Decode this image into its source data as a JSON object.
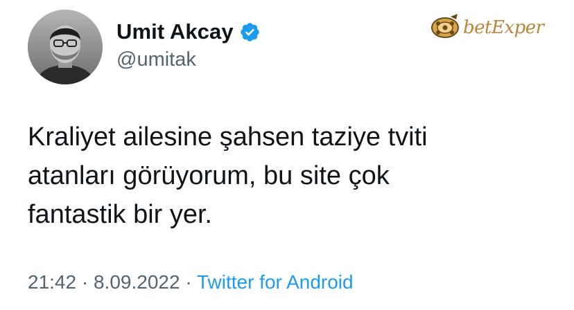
{
  "author": {
    "display_name": "Umit Akcay",
    "handle": "@umitak",
    "verified_icon": "verified-badge-icon",
    "avatar_icon": "profile-photo"
  },
  "watermark": {
    "brand_text": "betExper",
    "logo_icon": "film-reel-logo-icon"
  },
  "tweet": {
    "lines": [
      "Kraliyet ailesine şahsen taziye tviti",
      "atanları görüyorum, bu site çok",
      "fantastik bir yer."
    ]
  },
  "meta": {
    "time": "21:42",
    "separator": "·",
    "date": "8.09.2022",
    "source": "Twitter for Android"
  },
  "colors": {
    "text_primary": "#0f1419",
    "text_secondary": "#536471",
    "link_blue": "#1d9bf0",
    "watermark_gold": "#b8863a"
  }
}
